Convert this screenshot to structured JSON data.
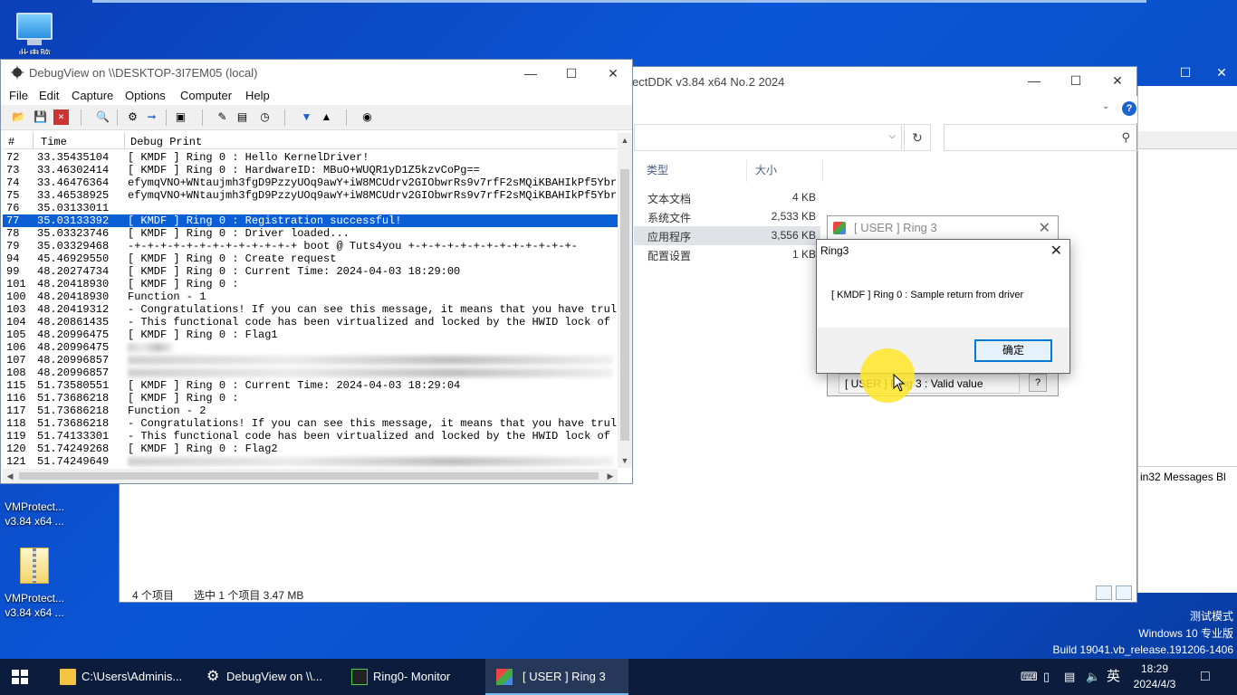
{
  "desktop": {
    "icons": [
      {
        "label": "此电脑"
      },
      {
        "label_line1": "VMProtect...",
        "label_line2": "v3.84 x64 ..."
      },
      {
        "label_line1": "VMProtect...",
        "label_line2": "v3.84 x64 ..."
      }
    ]
  },
  "explorer": {
    "title": "ectDDK v3.84 x64 No.2 2024",
    "columns": {
      "type": "类型",
      "size": "大小"
    },
    "files": [
      {
        "type": "文本文档",
        "size": "4 KB"
      },
      {
        "type": "系统文件",
        "size": "2,533 KB"
      },
      {
        "type": "应用程序",
        "size": "3,556 KB"
      },
      {
        "type": "配置设置",
        "size": "1 KB"
      }
    ],
    "status": {
      "count": "4 个项目",
      "selected": "选中 1 个项目  3.47 MB"
    }
  },
  "messages_window": {
    "tab": "in32 Messages Bl"
  },
  "debugview": {
    "title": "DebugView on \\\\DESKTOP-3I7EM05 (local)",
    "menu": [
      "File",
      "Edit",
      "Capture",
      "Options",
      "Computer",
      "Help"
    ],
    "columns": {
      "num": "#",
      "time": "Time",
      "print": "Debug Print"
    },
    "rows": [
      {
        "n": "72",
        "t": "33.35435104",
        "d": "[ KMDF ] Ring 0 : Hello KernelDriver!"
      },
      {
        "n": "73",
        "t": "33.46302414",
        "d": "[ KMDF ] Ring 0 : HardwareID: MBuO+WUQR1yD1Z5kzvCoPg=="
      },
      {
        "n": "74",
        "t": "33.46476364",
        "d": "efymqVNO+WNtaujmh3fgD9PzzyUOq9awY+iW8MCUdrv2GIObwrRs9v7rfF2sMQiKBAHIkPf5Ybr.."
      },
      {
        "n": "75",
        "t": "33.46538925",
        "d": "efymqVNO+WNtaujmh3fgD9PzzyUOq9awY+iW8MCUdrv2GIObwrRs9v7rfF2sMQiKBAHIkPf5Ybr.."
      },
      {
        "n": "76",
        "t": "35.03133011",
        "d": ""
      },
      {
        "n": "77",
        "t": "35.03133392",
        "d": "[ KMDF ] Ring 0 : Registration successful!"
      },
      {
        "n": "78",
        "t": "35.03323746",
        "d": "[ KMDF ] Ring 0 : Driver loaded..."
      },
      {
        "n": "79",
        "t": "35.03329468",
        "d": "-+-+-+-+-+-+-+-+-+-+-+-+-+ boot @ Tuts4you +-+-+-+-+-+-+-+-+-+-+-+-+-"
      },
      {
        "n": "94",
        "t": "45.46929550",
        "d": "[ KMDF ] Ring 0 : Create request"
      },
      {
        "n": "99",
        "t": "48.20274734",
        "d": "[ KMDF ] Ring 0 : Current Time: 2024-04-03 18:29:00"
      },
      {
        "n": "101",
        "t": "48.20418930",
        "d": "[ KMDF ] Ring 0 :"
      },
      {
        "n": "100",
        "t": "48.20418930",
        "d": "Function - 1"
      },
      {
        "n": "103",
        "t": "48.20419312",
        "d": "- Congratulations! If you can see this message, it means that you have trul.."
      },
      {
        "n": "104",
        "t": "48.20861435",
        "d": "- This functional code has been virtualized and locked by the HWID lock of .."
      },
      {
        "n": "105",
        "t": "48.20996475",
        "d": "[ KMDF ] Ring 0 : Flag1"
      },
      {
        "n": "106",
        "t": "48.20996475",
        "d": ""
      },
      {
        "n": "107",
        "t": "48.20996857",
        "d": ""
      },
      {
        "n": "108",
        "t": "48.20996857",
        "d": ""
      },
      {
        "n": "115",
        "t": "51.73580551",
        "d": "[ KMDF ] Ring 0 : Current Time: 2024-04-03 18:29:04"
      },
      {
        "n": "116",
        "t": "51.73686218",
        "d": "[ KMDF ] Ring 0 :"
      },
      {
        "n": "117",
        "t": "51.73686218",
        "d": "Function - 2"
      },
      {
        "n": "118",
        "t": "51.73686218",
        "d": "- Congratulations! If you can see this message, it means that you have trul.."
      },
      {
        "n": "119",
        "t": "51.74133301",
        "d": "- This functional code has been virtualized and locked by the HWID lock of .."
      },
      {
        "n": "120",
        "t": "51.74249268",
        "d": "[ KMDF ] Ring 0 : Flag2"
      },
      {
        "n": "121",
        "t": "51.74249649",
        "d": ""
      }
    ],
    "selected_row": "77"
  },
  "ring3_window": {
    "title": "[ USER ] Ring 3",
    "field_value": "[ USER ] Ring 3 : Valid value",
    "help_label": "?"
  },
  "msgbox": {
    "title": "Ring3",
    "message": "[ KMDF ] Ring 0 : Sample return from driver",
    "ok_label": "确定"
  },
  "watermark": {
    "line1": "测试模式",
    "line2": "Windows 10 专业版",
    "line3": "Build 19041.vb_release.191206-1406"
  },
  "taskbar": {
    "items": [
      {
        "label": "C:\\Users\\Adminis..."
      },
      {
        "label": "DebugView on \\\\..."
      },
      {
        "label": "Ring0- Monitor"
      },
      {
        "label": "[ USER ] Ring 3"
      }
    ],
    "ime": "英",
    "time": "18:29",
    "date": "2024/4/3"
  }
}
